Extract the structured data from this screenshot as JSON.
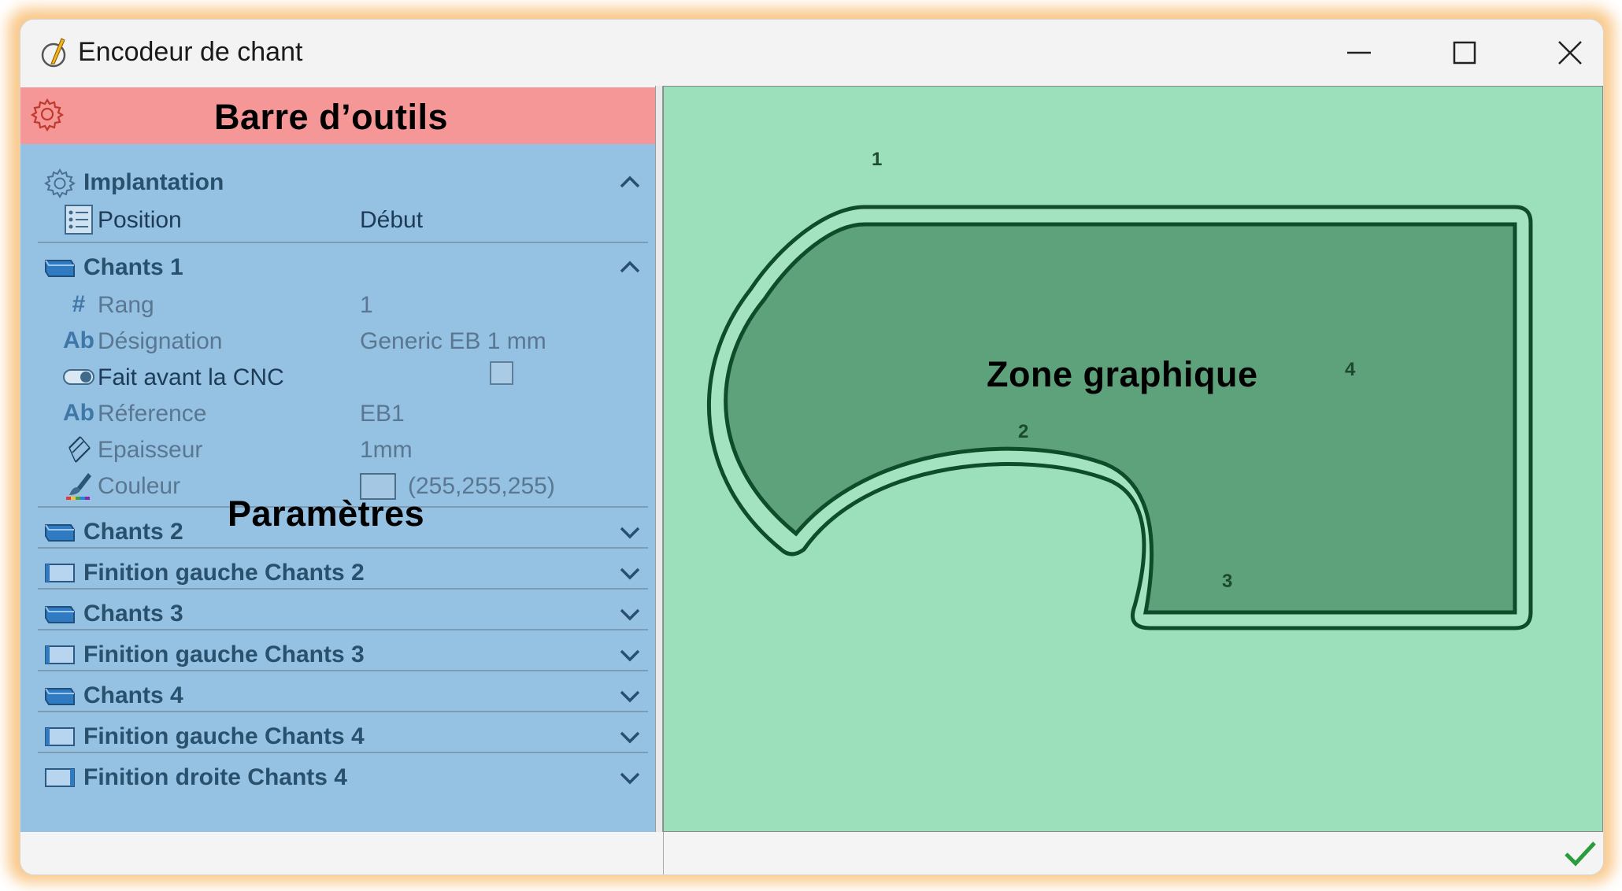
{
  "window": {
    "title": "Encodeur de chant"
  },
  "overlays": {
    "toolbar": "Barre d’outils",
    "params": "Paramètres",
    "graphic": "Zone graphique"
  },
  "implantation": {
    "label": "Implantation",
    "position": {
      "name": "Position",
      "value": "Début"
    }
  },
  "chants1": {
    "label": "Chants 1",
    "rang": {
      "name": "Rang",
      "value": "1"
    },
    "designation": {
      "name": "Désignation",
      "value": "Generic EB 1 mm"
    },
    "fait_avant": {
      "name": "Fait avant la CNC",
      "checked": false
    },
    "reference": {
      "name": "Réference",
      "value": "EB1"
    },
    "epaisseur": {
      "name": "Epaisseur",
      "value": "1mm"
    },
    "couleur": {
      "name": "Couleur",
      "value": "(255,255,255)"
    }
  },
  "sections": [
    {
      "label": "Chants 2"
    },
    {
      "label": "Finition gauche Chants 2"
    },
    {
      "label": "Chants 3"
    },
    {
      "label": "Finition gauche Chants 3"
    },
    {
      "label": "Chants 4"
    },
    {
      "label": "Finition gauche Chants 4"
    },
    {
      "label": "Finition droite Chants 4"
    }
  ],
  "drawing": {
    "edge_labels": [
      "1",
      "2",
      "3",
      "4"
    ]
  },
  "colors": {
    "toolbar": "#f59796",
    "params_bg": "#95c1e2",
    "graphic_bg": "#9cdfbb",
    "piece_fill": "#5da27b",
    "edge_band": "#a3e3bf",
    "outline": "#0f4d2a",
    "confirm": "#2a9c3c"
  }
}
